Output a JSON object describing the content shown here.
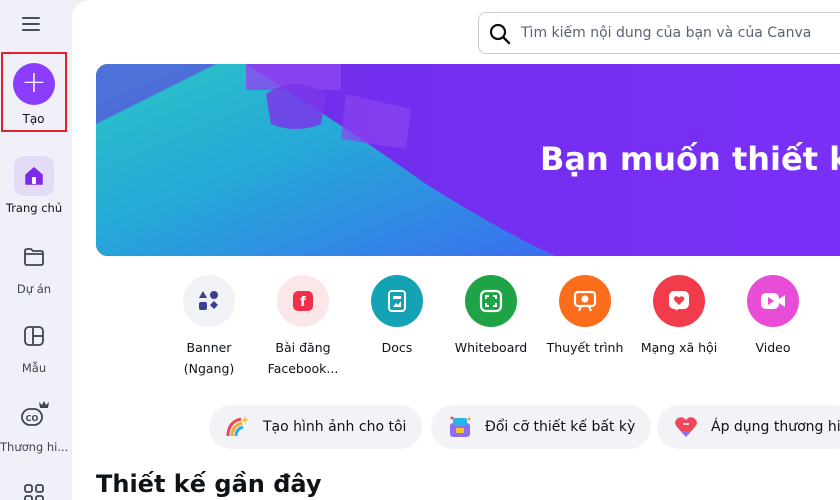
{
  "sidebar": {
    "create_label": "Tạo",
    "items": [
      {
        "label": "Trang chủ",
        "icon": "home-icon"
      },
      {
        "label": "Dự án",
        "icon": "folder-icon"
      },
      {
        "label": "Mẫu",
        "icon": "template-icon"
      },
      {
        "label": "Thương hi...",
        "icon": "brand-icon"
      },
      {
        "label": "",
        "icon": "apps-icon"
      }
    ]
  },
  "search": {
    "placeholder": "Tìm kiếm nội dung của bạn và của Canva"
  },
  "banner": {
    "title": "Bạn muốn thiết k"
  },
  "categories": [
    {
      "line1": "Banner",
      "line2": "(Ngang)",
      "icon": "shapes-icon",
      "color": "#f1f2f5"
    },
    {
      "line1": "Bài đăng",
      "line2": "Facebook...",
      "icon": "facebook-icon",
      "color": "#fbe7e8"
    },
    {
      "line1": "Docs",
      "line2": "",
      "icon": "docs-icon",
      "color": "#13a3b5"
    },
    {
      "line1": "Whiteboard",
      "line2": "",
      "icon": "whiteboard-icon",
      "color": "#1ea446"
    },
    {
      "line1": "Thuyết trình",
      "line2": "",
      "icon": "presentation-icon",
      "color": "#fc6d1b"
    },
    {
      "line1": "Mạng xã hội",
      "line2": "",
      "icon": "heart-icon",
      "color": "#f23b4b"
    },
    {
      "line1": "Video",
      "line2": "",
      "icon": "video-icon",
      "color": "#e94dd8"
    }
  ],
  "chips": [
    {
      "label": "Tạo hình ảnh cho tôi",
      "icon": "rainbow-icon"
    },
    {
      "label": "Đổi cỡ thiết kế bất kỳ",
      "icon": "resize-icon"
    },
    {
      "label": "Áp dụng thương hi",
      "icon": "brand-heart-icon"
    }
  ],
  "recent": {
    "title": "Thiết kế gần đây"
  },
  "colors": {
    "accent": "#8b3dff",
    "highlight": "#e0222c"
  }
}
